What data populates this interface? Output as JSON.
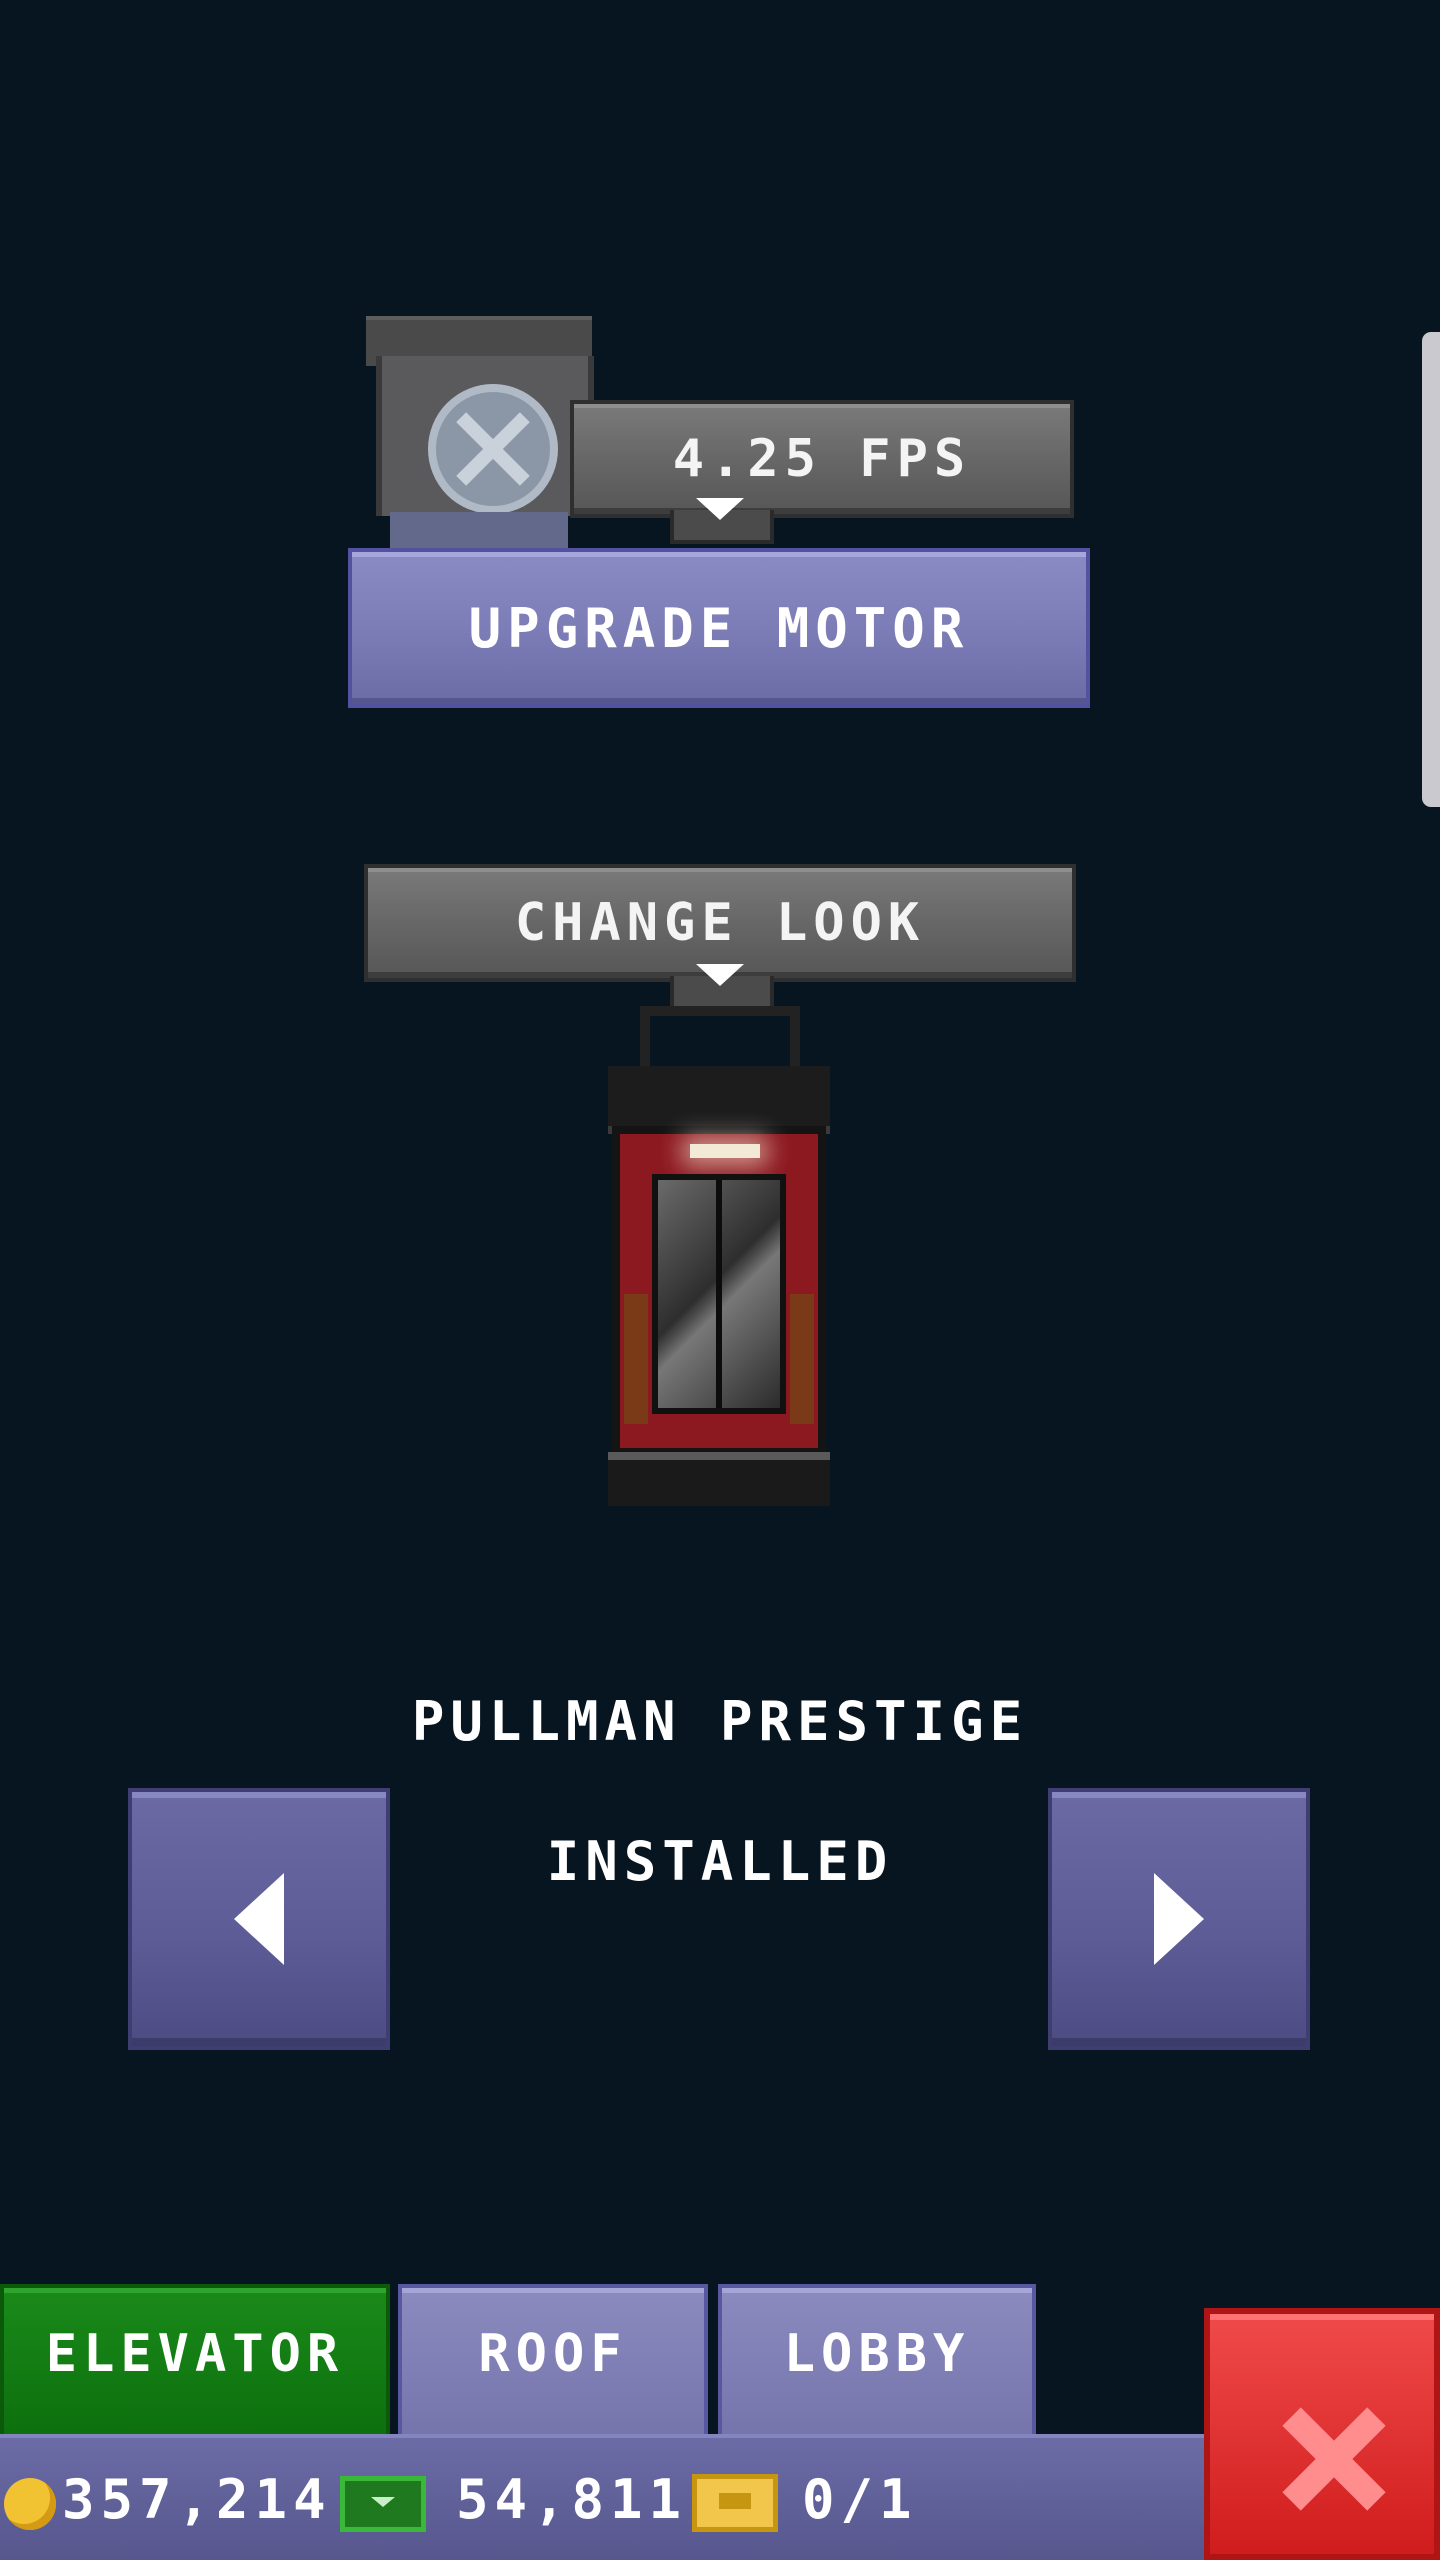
{
  "motor": {
    "speed_label": "4.25 FPS",
    "upgrade_label": "UPGRADE MOTOR"
  },
  "look": {
    "change_label": "CHANGE LOOK",
    "elevator_name": "PULLMAN PRESTIGE",
    "status": "INSTALLED"
  },
  "tabs": [
    {
      "label": "ELEVATOR",
      "active": true
    },
    {
      "label": "ROOF",
      "active": false
    },
    {
      "label": "LOBBY",
      "active": false
    }
  ],
  "currency": {
    "coins": "357,214",
    "bux": "54,811",
    "tickets": "0/1"
  },
  "icons": {
    "coin": "coin-icon",
    "bux": "bux-icon",
    "ticket": "ticket-icon",
    "close": "close-icon",
    "prev": "arrow-left-icon",
    "next": "arrow-right-icon"
  },
  "colors": {
    "background": "#061520",
    "purple_button": "#7b7bb6",
    "active_tab": "#0d700d",
    "close_button": "#d01c1c"
  }
}
